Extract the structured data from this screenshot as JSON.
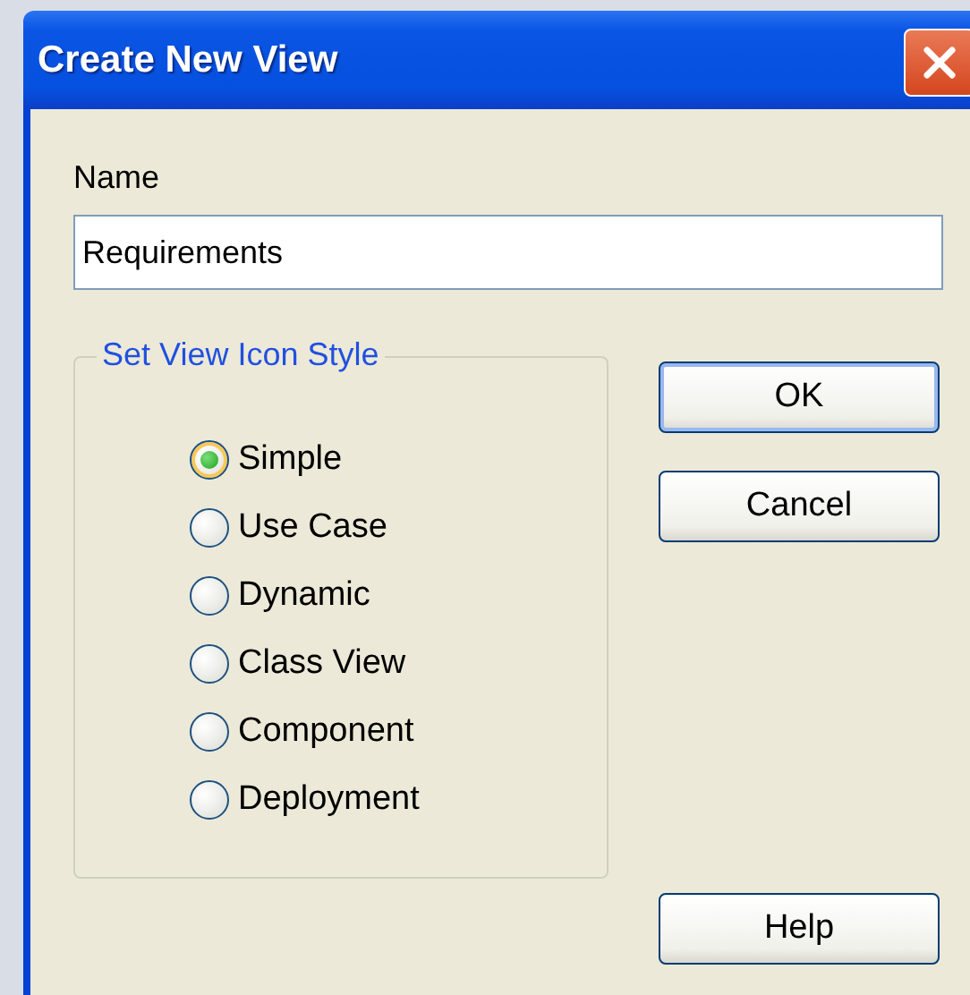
{
  "window": {
    "title": "Create New View"
  },
  "name_field": {
    "label": "Name",
    "value": "Requirements"
  },
  "icon_style": {
    "title": "Set View Icon Style",
    "options": [
      {
        "label": "Simple",
        "selected": true
      },
      {
        "label": "Use Case",
        "selected": false
      },
      {
        "label": "Dynamic",
        "selected": false
      },
      {
        "label": "Class View",
        "selected": false
      },
      {
        "label": "Component",
        "selected": false
      },
      {
        "label": "Deployment",
        "selected": false
      }
    ]
  },
  "buttons": [
    {
      "label": "OK",
      "kind": "default"
    },
    {
      "label": "Cancel",
      "kind": "normal"
    },
    {
      "label": "Help",
      "kind": "normal"
    }
  ]
}
